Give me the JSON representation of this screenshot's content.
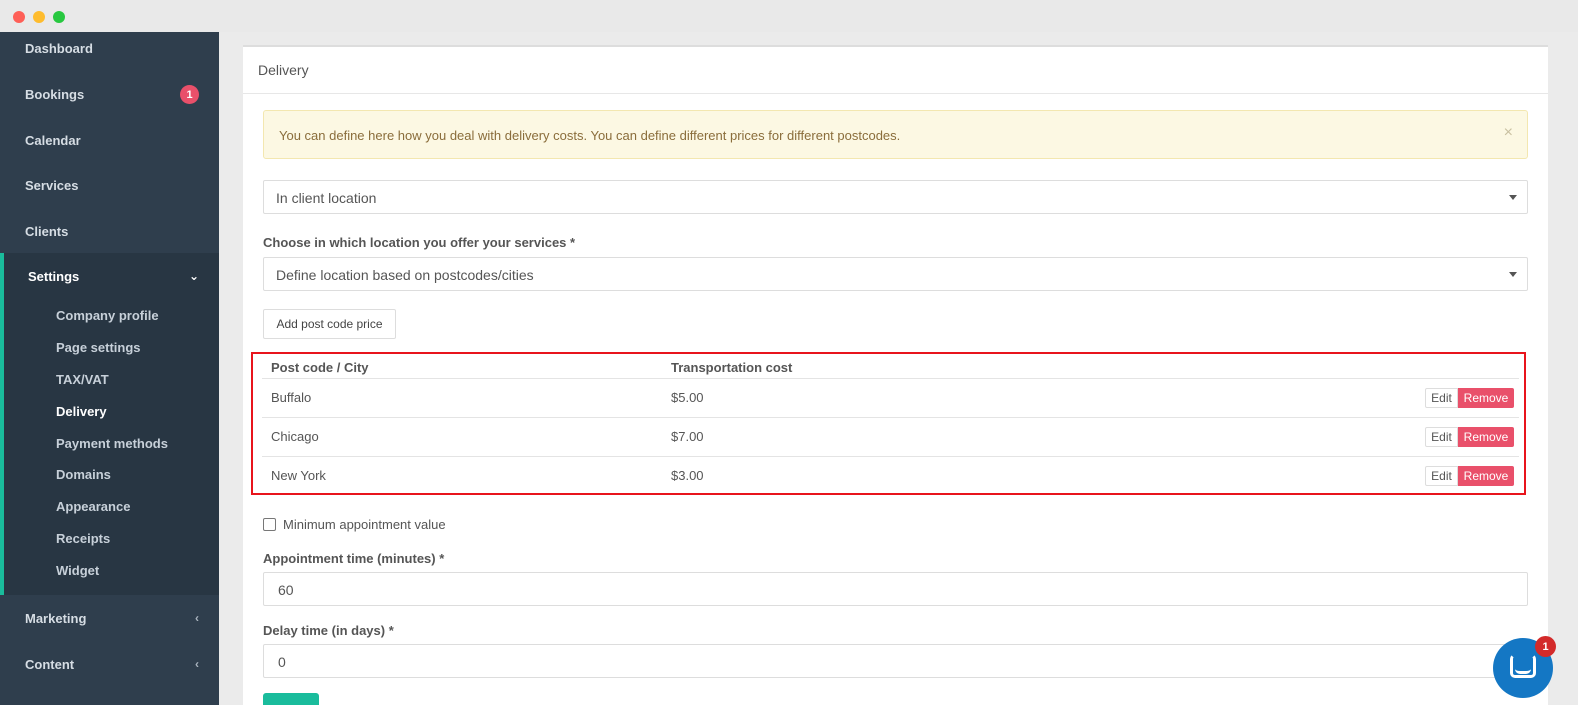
{
  "sidebar": {
    "items": [
      {
        "label": "Dashboard"
      },
      {
        "label": "Bookings",
        "badge": "1"
      },
      {
        "label": "Calendar"
      },
      {
        "label": "Services"
      },
      {
        "label": "Clients"
      }
    ],
    "settings": {
      "label": "Settings",
      "subitems": [
        "Company profile",
        "Page settings",
        "TAX/VAT",
        "Delivery",
        "Payment methods",
        "Domains",
        "Appearance",
        "Receipts",
        "Widget"
      ],
      "active": "Delivery"
    },
    "after_items": [
      {
        "label": "Marketing"
      },
      {
        "label": "Content"
      }
    ]
  },
  "panel": {
    "title": "Delivery",
    "alert": "You can define here how you deal with delivery costs. You can define different prices for different postcodes.",
    "alert_close": "×",
    "delivery_mode": "In client location",
    "location_label": "Choose in which location you offer your services *",
    "location_value": "Define location based on postcodes/cities",
    "add_button": "Add post code price",
    "table": {
      "headers": [
        "Post code / City",
        "Transportation cost"
      ],
      "rows": [
        {
          "city": "Buffalo",
          "cost": "$5.00"
        },
        {
          "city": "Chicago",
          "cost": "$7.00"
        },
        {
          "city": "New York",
          "cost": "$3.00"
        }
      ],
      "edit_label": "Edit",
      "remove_label": "Remove"
    },
    "min_value_label": "Minimum appointment value",
    "appointment_time_label": "Appointment time (minutes) *",
    "appointment_time_value": "60",
    "delay_label": "Delay time (in days) *",
    "delay_value": "0"
  },
  "chat": {
    "badge": "1"
  },
  "colors": {
    "sidebar": "#2f3e4d",
    "accent": "#1abc9c",
    "danger": "#e9506a",
    "highlight": "#e8141c",
    "chat": "#1477c4"
  }
}
